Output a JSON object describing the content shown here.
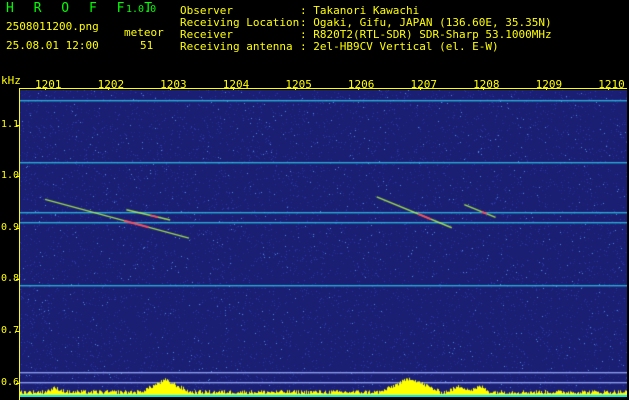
{
  "header": {
    "app_name": "H R O F F T",
    "version": "1.0.0",
    "filename": "2508011200.png",
    "meteor_label": "meteor",
    "datetime": "25.08.01 12:00",
    "meteor_count": "51",
    "info": [
      {
        "key": "Observer",
        "value": ": Takanori Kawachi"
      },
      {
        "key": "Receiving Location",
        "value": ": Ogaki, Gifu, JAPAN (136.60E, 35.35N)"
      },
      {
        "key": "Receiver",
        "value": ": R820T2(RTL-SDR) SDR-Sharp 53.1000MHz"
      },
      {
        "key": "Receiving antenna",
        "value": ": 2el-HB9CV Vertical (el. E-W)"
      }
    ]
  },
  "chart_data": {
    "type": "heatmap",
    "ylabel": "kHz",
    "x_ticks": [
      "1201",
      "1202",
      "1203",
      "1204",
      "1205",
      "1206",
      "1207",
      "1208",
      "1209",
      "1210"
    ],
    "y_ticks": [
      "1.1",
      "1.0",
      "0.9",
      "0.8",
      "0.7",
      "0.6"
    ],
    "y_range": [
      0.6,
      1.15
    ],
    "x_range": [
      1200.6,
      1210.3
    ],
    "carriers_khz": [
      1.147,
      1.027,
      0.93,
      0.911,
      0.79,
      0.621,
      0.601
    ],
    "meteor_echoes": [
      {
        "x_start": 1201.0,
        "f_start": 0.955,
        "x_end": 1203.3,
        "f_end": 0.88
      },
      {
        "x_start": 1202.3,
        "f_start": 0.935,
        "x_end": 1203.0,
        "f_end": 0.915
      },
      {
        "x_start": 1206.3,
        "f_start": 0.96,
        "x_end": 1207.5,
        "f_end": 0.9
      },
      {
        "x_start": 1207.7,
        "f_start": 0.945,
        "x_end": 1208.2,
        "f_end": 0.92
      }
    ],
    "colors": {
      "background": "#1a1f74",
      "carrier": "#2ec6e8",
      "echo": "#b8ff40",
      "echo_core": "#ff4060",
      "activity": "#ffff00",
      "axis": "#ffff00"
    }
  }
}
